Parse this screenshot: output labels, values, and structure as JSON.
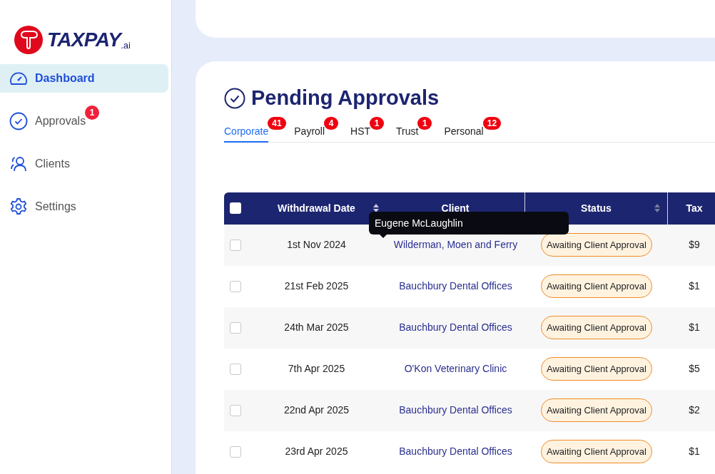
{
  "logo": {
    "wordmark": "TAXPAY",
    "suffix": ".ai"
  },
  "sidebar": {
    "items": [
      {
        "kind": "dashboard",
        "label": "Dashboard",
        "selected": true
      },
      {
        "kind": "approvals",
        "label": "Approvals",
        "selected": false,
        "badge": "1"
      },
      {
        "kind": "clients",
        "label": "Clients",
        "selected": false
      },
      {
        "kind": "settings",
        "label": "Settings",
        "selected": false
      }
    ]
  },
  "page": {
    "title": "Pending Approvals"
  },
  "tabs": [
    {
      "label": "Corporate",
      "badge": "41",
      "selected": true
    },
    {
      "label": "Payroll",
      "badge": "4",
      "selected": false
    },
    {
      "label": "HST",
      "badge": "1",
      "selected": false
    },
    {
      "label": "Trust",
      "badge": "1",
      "selected": false
    },
    {
      "label": "Personal",
      "badge": "12",
      "selected": false
    }
  ],
  "table": {
    "columns": [
      {
        "label": "Withdrawal Date",
        "sortable": true
      },
      {
        "label": "Client",
        "sortable": false
      },
      {
        "label": "Status",
        "sortable": true
      },
      {
        "label": "Tax",
        "sortable": false
      }
    ],
    "select_all_checked": false,
    "rows": [
      {
        "checked": false,
        "date": "1st Nov 2024",
        "client": "Wilderman, Moen and Ferry",
        "status": "Awaiting Client Approval",
        "amount": "$9"
      },
      {
        "checked": false,
        "date": "21st Feb 2025",
        "client": "Bauchbury Dental Offices",
        "status": "Awaiting Client Approval",
        "amount": "$1"
      },
      {
        "checked": false,
        "date": "24th Mar 2025",
        "client": "Bauchbury Dental Offices",
        "status": "Awaiting Client Approval",
        "amount": "$1"
      },
      {
        "checked": false,
        "date": "7th Apr 2025",
        "client": "O'Kon Veterinary Clinic",
        "status": "Awaiting Client Approval",
        "amount": "$5"
      },
      {
        "checked": false,
        "date": "22nd Apr 2025",
        "client": "Bauchbury Dental Offices",
        "status": "Awaiting Client Approval",
        "amount": "$2"
      },
      {
        "checked": false,
        "date": "23rd Apr 2025",
        "client": "Bauchbury Dental Offices",
        "status": "Awaiting Client Approval",
        "amount": "$1"
      }
    ]
  },
  "tooltip": {
    "text": "Eugene McLaughlin"
  }
}
